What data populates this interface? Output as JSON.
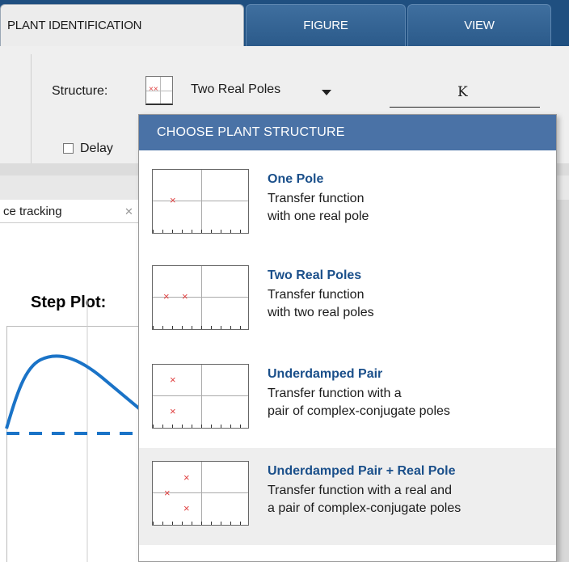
{
  "tabs": [
    {
      "label": "PLANT IDENTIFICATION",
      "active": true
    },
    {
      "label": "FIGURE",
      "active": false
    },
    {
      "label": "VIEW",
      "active": false
    }
  ],
  "toolstrip": {
    "structure_label": "Structure:",
    "structure_value": "Two Real Poles",
    "tf_numerator": "K",
    "delay_label": "Delay",
    "delay_checked": false
  },
  "document": {
    "tab_label": "ce tracking",
    "close_glyph": "✕",
    "plot_title": "Step Plot:"
  },
  "dropdown": {
    "header": "CHOOSE PLANT STRUCTURE",
    "options": [
      {
        "title": "One Pole",
        "line1": "Transfer function",
        "line2": "with one real pole",
        "highlighted": false
      },
      {
        "title": "Two Real Poles",
        "line1": "Transfer function",
        "line2": "with two real poles",
        "highlighted": false
      },
      {
        "title": "Underdamped Pair",
        "line1": "Transfer function with a",
        "line2": "pair of complex-conjugate poles",
        "highlighted": false
      },
      {
        "title": "Underdamped Pair + Real Pole",
        "line1": "Transfer function with a real and",
        "line2": "a pair of complex-conjugate poles",
        "highlighted": true
      }
    ]
  },
  "colors": {
    "tab_bar": "#1f4f80",
    "dropdown_header": "#4a72a6",
    "option_title": "#1a4f8a",
    "pole_marker": "#e04040",
    "plot_line": "#1a73c7"
  },
  "icons": {
    "pole": "x-mark-icon",
    "caret": "chevron-down-icon",
    "close": "close-icon"
  }
}
